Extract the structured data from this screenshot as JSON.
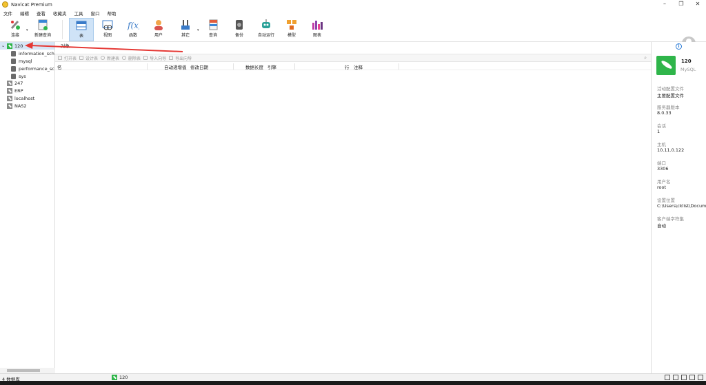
{
  "window": {
    "title": "Navicat Premium",
    "controls": [
      "–",
      "❐",
      "✕"
    ]
  },
  "menu": [
    "文件",
    "编辑",
    "查看",
    "收藏夹",
    "工具",
    "窗口",
    "帮助"
  ],
  "toolbar": [
    {
      "id": "connect",
      "label": "连接",
      "icon": "plug-icon"
    },
    {
      "id": "new-query",
      "label": "新建查询",
      "icon": "new-query-icon"
    },
    {
      "id": "table",
      "label": "表",
      "icon": "table-icon",
      "active": true
    },
    {
      "id": "view",
      "label": "视图",
      "icon": "view-icon"
    },
    {
      "id": "function",
      "label": "函数",
      "icon": "function-icon"
    },
    {
      "id": "user",
      "label": "用户",
      "icon": "user-icon"
    },
    {
      "id": "other",
      "label": "其它",
      "icon": "tools-icon"
    },
    {
      "id": "query",
      "label": "查询",
      "icon": "query-icon"
    },
    {
      "id": "backup",
      "label": "备份",
      "icon": "backup-icon"
    },
    {
      "id": "automation",
      "label": "自动运行",
      "icon": "robot-icon"
    },
    {
      "id": "model",
      "label": "模型",
      "icon": "model-icon"
    },
    {
      "id": "chart",
      "label": "图表",
      "icon": "chart-icon"
    }
  ],
  "sidebar": {
    "connections": [
      {
        "name": "120",
        "status": "open",
        "databases": [
          "information_schema",
          "mysql",
          "performance_schema",
          "sys"
        ]
      },
      {
        "name": "247"
      },
      {
        "name": "ERP"
      },
      {
        "name": "localhost"
      },
      {
        "name": "NAS2"
      }
    ]
  },
  "tab": {
    "label": "对象"
  },
  "object_actions": [
    "打开表",
    "设计表",
    "新建表",
    "删除表",
    "导入向导",
    "导出向导"
  ],
  "columns": [
    "名",
    "自动递增值",
    "修改日期",
    "数据长度",
    "引擎",
    "行",
    "注释"
  ],
  "info_panel": {
    "name": "120",
    "type": "MySQL",
    "fields": [
      {
        "label": "活动配置文件",
        "value": "主要配置文件"
      },
      {
        "label": "服务器版本",
        "value": "8.0.33"
      },
      {
        "label": "会话",
        "value": "1"
      },
      {
        "label": "主机",
        "value": "10.11.0.122"
      },
      {
        "label": "端口",
        "value": "3306"
      },
      {
        "label": "用户名",
        "value": "root"
      },
      {
        "label": "设置位置",
        "value": "C:\\Users\\cklist\\Documents\\Navicat"
      },
      {
        "label": "客户端字符集",
        "value": "自动"
      }
    ]
  },
  "status": {
    "db_count": "4 数据库",
    "connection": "120"
  },
  "colors": {
    "accent": "#cfe3f7",
    "conn_green": "#2fb54a",
    "annotation_arrow": "#e53935"
  }
}
